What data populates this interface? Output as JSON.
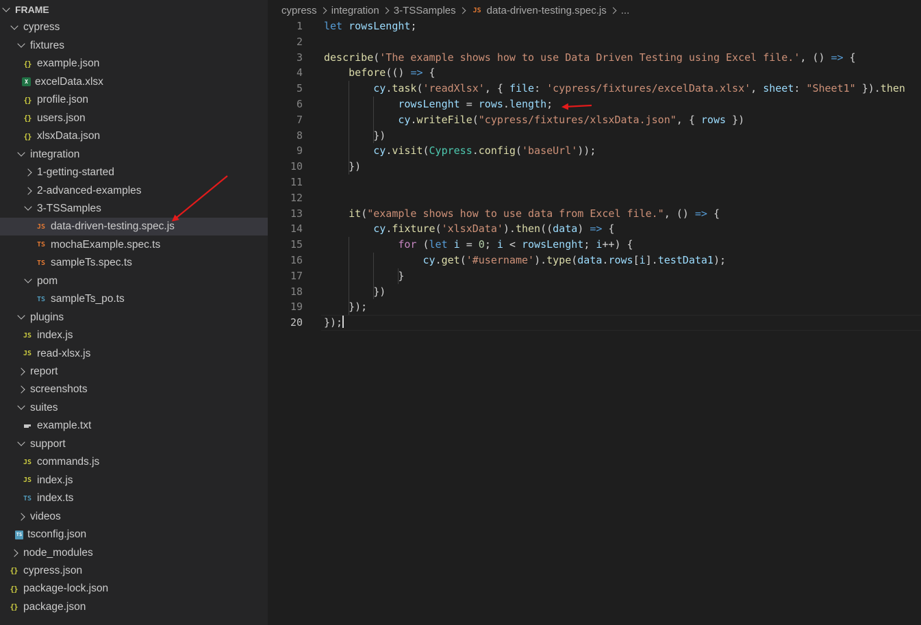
{
  "explorer": {
    "title": "FRAME",
    "items": [
      {
        "label": "FRAME",
        "type": "root"
      },
      {
        "label": "cypress",
        "type": "folder-open"
      },
      {
        "label": "fixtures",
        "type": "folder-open"
      },
      {
        "label": "example.json",
        "type": "json"
      },
      {
        "label": "excelData.xlsx",
        "type": "xlsx"
      },
      {
        "label": "profile.json",
        "type": "json"
      },
      {
        "label": "users.json",
        "type": "json"
      },
      {
        "label": "xlsxData.json",
        "type": "json"
      },
      {
        "label": "integration",
        "type": "folder-open"
      },
      {
        "label": "1-getting-started",
        "type": "folder-closed"
      },
      {
        "label": "2-advanced-examples",
        "type": "folder-closed"
      },
      {
        "label": "3-TSSamples",
        "type": "folder-open"
      },
      {
        "label": "data-driven-testing.spec.js",
        "type": "js-red",
        "selected": true
      },
      {
        "label": "mochaExample.spec.ts",
        "type": "ts-orange"
      },
      {
        "label": "sampleTs.spec.ts",
        "type": "ts-orange"
      },
      {
        "label": "pom",
        "type": "folder-open"
      },
      {
        "label": "sampleTs_po.ts",
        "type": "ts-blue"
      },
      {
        "label": "plugins",
        "type": "folder-open"
      },
      {
        "label": "index.js",
        "type": "js"
      },
      {
        "label": "read-xlsx.js",
        "type": "js"
      },
      {
        "label": "report",
        "type": "folder-closed"
      },
      {
        "label": "screenshots",
        "type": "folder-closed"
      },
      {
        "label": "suites",
        "type": "folder-open"
      },
      {
        "label": "example.txt",
        "type": "txt"
      },
      {
        "label": "support",
        "type": "folder-open"
      },
      {
        "label": "commands.js",
        "type": "js"
      },
      {
        "label": "index.js",
        "type": "js"
      },
      {
        "label": "index.ts",
        "type": "ts-blue"
      },
      {
        "label": "videos",
        "type": "folder-closed"
      },
      {
        "label": "tsconfig.json",
        "type": "tsconfig"
      },
      {
        "label": "node_modules",
        "type": "folder-closed"
      },
      {
        "label": "cypress.json",
        "type": "json"
      },
      {
        "label": "package-lock.json",
        "type": "json"
      },
      {
        "label": "package.json",
        "type": "json"
      }
    ]
  },
  "icons": {
    "json": "{}",
    "js": "JS",
    "ts": "TS",
    "xlsx": "X",
    "tsconfig": "TS"
  },
  "breadcrumb": {
    "parts": [
      "cypress",
      "integration",
      "3-TSSamples"
    ],
    "file": "data-driven-testing.spec.js",
    "ellipsis": "..."
  },
  "editor": {
    "active_line": 20,
    "lines": [
      {
        "n": "1"
      },
      {
        "n": "2"
      },
      {
        "n": "3"
      },
      {
        "n": "4"
      },
      {
        "n": "5"
      },
      {
        "n": "6"
      },
      {
        "n": "7"
      },
      {
        "n": "8"
      },
      {
        "n": "9"
      },
      {
        "n": "10"
      },
      {
        "n": "11"
      },
      {
        "n": "12"
      },
      {
        "n": "13"
      },
      {
        "n": "14"
      },
      {
        "n": "15"
      },
      {
        "n": "16"
      },
      {
        "n": "17"
      },
      {
        "n": "18"
      },
      {
        "n": "19"
      },
      {
        "n": "20"
      }
    ],
    "code": [
      [
        [
          "k",
          "let"
        ],
        [
          "p",
          " "
        ],
        [
          "v",
          "rowsLenght"
        ],
        [
          "p",
          ";"
        ]
      ],
      [],
      [
        [
          "f",
          "describe"
        ],
        [
          "p",
          "("
        ],
        [
          "s",
          "'The example shows how to use Data Driven Testing using Excel file.'"
        ],
        [
          "p",
          ", () "
        ],
        [
          "k",
          "=>"
        ],
        [
          "p",
          " {"
        ]
      ],
      [
        [
          "p",
          "    "
        ],
        [
          "f",
          "before"
        ],
        [
          "p",
          "(() "
        ],
        [
          "k",
          "=>"
        ],
        [
          "p",
          " {"
        ]
      ],
      [
        [
          "p",
          "        "
        ],
        [
          "v",
          "cy"
        ],
        [
          "p",
          "."
        ],
        [
          "f",
          "task"
        ],
        [
          "p",
          "("
        ],
        [
          "s",
          "'readXlsx'"
        ],
        [
          "p",
          ", { "
        ],
        [
          "v",
          "file"
        ],
        [
          "p",
          ": "
        ],
        [
          "s",
          "'cypress/fixtures/excelData.xlsx'"
        ],
        [
          "p",
          ", "
        ],
        [
          "v",
          "sheet"
        ],
        [
          "p",
          ": "
        ],
        [
          "s",
          "\"Sheet1\""
        ],
        [
          "p",
          " })."
        ],
        [
          "f",
          "then"
        ]
      ],
      [
        [
          "p",
          "            "
        ],
        [
          "v",
          "rowsLenght"
        ],
        [
          "p",
          " = "
        ],
        [
          "v",
          "rows"
        ],
        [
          "p",
          "."
        ],
        [
          "v",
          "length"
        ],
        [
          "p",
          ";"
        ]
      ],
      [
        [
          "p",
          "            "
        ],
        [
          "v",
          "cy"
        ],
        [
          "p",
          "."
        ],
        [
          "f",
          "writeFile"
        ],
        [
          "p",
          "("
        ],
        [
          "s",
          "\"cypress/fixtures/xlsxData.json\""
        ],
        [
          "p",
          ", { "
        ],
        [
          "v",
          "rows"
        ],
        [
          "p",
          " })"
        ]
      ],
      [
        [
          "p",
          "        })"
        ]
      ],
      [
        [
          "p",
          "        "
        ],
        [
          "v",
          "cy"
        ],
        [
          "p",
          "."
        ],
        [
          "f",
          "visit"
        ],
        [
          "p",
          "("
        ],
        [
          "t",
          "Cypress"
        ],
        [
          "p",
          "."
        ],
        [
          "f",
          "config"
        ],
        [
          "p",
          "("
        ],
        [
          "s",
          "'baseUrl'"
        ],
        [
          "p",
          "));"
        ]
      ],
      [
        [
          "p",
          "    })"
        ]
      ],
      [],
      [],
      [
        [
          "p",
          "    "
        ],
        [
          "f",
          "it"
        ],
        [
          "p",
          "("
        ],
        [
          "s",
          "\"example shows how to use data from Excel file.\""
        ],
        [
          "p",
          ", () "
        ],
        [
          "k",
          "=>"
        ],
        [
          "p",
          " {"
        ]
      ],
      [
        [
          "p",
          "        "
        ],
        [
          "v",
          "cy"
        ],
        [
          "p",
          "."
        ],
        [
          "f",
          "fixture"
        ],
        [
          "p",
          "("
        ],
        [
          "s",
          "'xlsxData'"
        ],
        [
          "p",
          ")."
        ],
        [
          "f",
          "then"
        ],
        [
          "p",
          "(("
        ],
        [
          "v",
          "data"
        ],
        [
          "p",
          ") "
        ],
        [
          "k",
          "=>"
        ],
        [
          "p",
          " {"
        ]
      ],
      [
        [
          "p",
          "            "
        ],
        [
          "c",
          "for"
        ],
        [
          "p",
          " ("
        ],
        [
          "k",
          "let"
        ],
        [
          "p",
          " "
        ],
        [
          "v",
          "i"
        ],
        [
          "p",
          " = "
        ],
        [
          "n",
          "0"
        ],
        [
          "p",
          "; "
        ],
        [
          "v",
          "i"
        ],
        [
          "p",
          " < "
        ],
        [
          "v",
          "rowsLenght"
        ],
        [
          "p",
          "; "
        ],
        [
          "v",
          "i"
        ],
        [
          "p",
          "++) {"
        ]
      ],
      [
        [
          "p",
          "                "
        ],
        [
          "v",
          "cy"
        ],
        [
          "p",
          "."
        ],
        [
          "f",
          "get"
        ],
        [
          "p",
          "("
        ],
        [
          "s",
          "'#username'"
        ],
        [
          "p",
          ")."
        ],
        [
          "f",
          "type"
        ],
        [
          "p",
          "("
        ],
        [
          "v",
          "data"
        ],
        [
          "p",
          "."
        ],
        [
          "v",
          "rows"
        ],
        [
          "p",
          "["
        ],
        [
          "v",
          "i"
        ],
        [
          "p",
          "]."
        ],
        [
          "v",
          "testData1"
        ],
        [
          "p",
          ");"
        ]
      ],
      [
        [
          "p",
          "            }"
        ]
      ],
      [
        [
          "p",
          "        })"
        ]
      ],
      [
        [
          "p",
          "    });"
        ]
      ],
      [
        [
          "p",
          "});"
        ]
      ]
    ]
  },
  "colors": {
    "sidebar_bg": "#252526",
    "editor_bg": "#1e1e1e",
    "selected_row": "#37373d",
    "annotation_arrow": "#e31b1b"
  }
}
